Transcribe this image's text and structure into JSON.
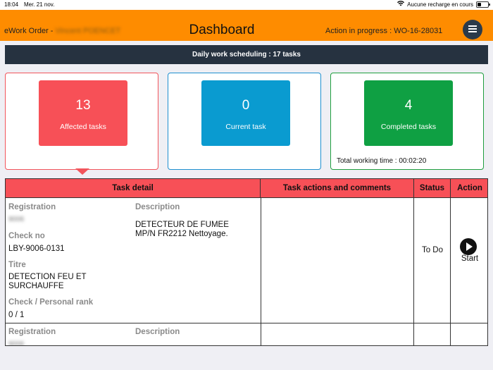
{
  "status_bar": {
    "time": "18:04",
    "date": "Mer. 21 nov.",
    "charging": "Aucune recharge en cours"
  },
  "header": {
    "app_prefix": "eWork Order -",
    "user_name": "Vincent POENCET",
    "title": "Dashboard",
    "action": "Action in progress : WO-16-28031",
    "menu_icon": "hamburger-menu-icon"
  },
  "schedule_banner": "Daily work scheduling : 17 tasks",
  "cards": {
    "affected": {
      "count": "13",
      "label": "Affected tasks",
      "color": "#f75057"
    },
    "current": {
      "count": "0",
      "label": "Current task",
      "color": "#0a9bd0"
    },
    "completed": {
      "count": "4",
      "label": "Completed tasks",
      "color": "#0fa043",
      "working_time": "Total working time : 00:02:20"
    }
  },
  "table": {
    "headers": {
      "detail": "Task detail",
      "actions": "Task actions and comments",
      "status": "Status",
      "action": "Action"
    },
    "rows": [
      {
        "registration_label": "Registration",
        "registration_value": "9006",
        "description_label": "Description",
        "description_line1": "DETECTEUR DE FUMEE",
        "description_line2": "MP/N FR2212 Nettoyage.",
        "check_label": "Check no",
        "check_value": "LBY-9006-0131",
        "title_label": "Titre",
        "title_line1": "DETECTION FEU ET",
        "title_line2": "SURCHAUFFE",
        "rank_label": "Check / Personal rank",
        "rank_value": "0 / 1",
        "status": "To Do",
        "action_label": "Start"
      },
      {
        "registration_label": "Registration",
        "registration_value": "9006",
        "description_label": "Description"
      }
    ]
  }
}
